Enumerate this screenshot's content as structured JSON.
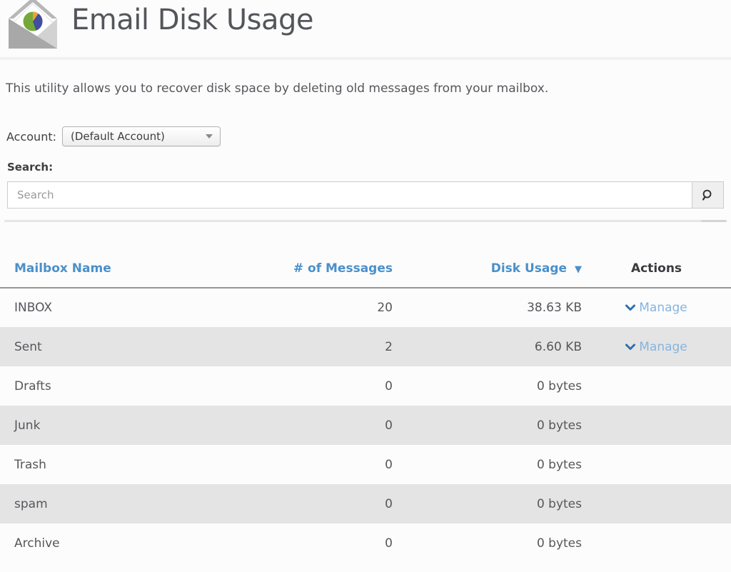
{
  "header": {
    "title": "Email Disk Usage",
    "icon": "envelope-pie-chart-icon"
  },
  "description": "This utility allows you to recover disk space by deleting old messages from your mailbox.",
  "account": {
    "label": "Account:",
    "selected": "(Default Account)"
  },
  "search": {
    "label": "Search:",
    "placeholder": "Search",
    "button_icon": "magnifier-icon"
  },
  "table": {
    "headers": {
      "mailbox": "Mailbox Name",
      "messages": "# of Messages",
      "disk_usage": "Disk Usage",
      "actions": "Actions"
    },
    "sort_indicator": "▼",
    "sorted_by": "Disk Usage",
    "sort_direction": "descending",
    "manage_label": "Manage",
    "rows": [
      {
        "mailbox": "INBOX",
        "messages": "20",
        "disk_usage": "38.63 KB",
        "manage": true
      },
      {
        "mailbox": "Sent",
        "messages": "2",
        "disk_usage": "6.60 KB",
        "manage": true
      },
      {
        "mailbox": "Drafts",
        "messages": "0",
        "disk_usage": "0 bytes",
        "manage": false
      },
      {
        "mailbox": "Junk",
        "messages": "0",
        "disk_usage": "0 bytes",
        "manage": false
      },
      {
        "mailbox": "Trash",
        "messages": "0",
        "disk_usage": "0 bytes",
        "manage": false
      },
      {
        "mailbox": "spam",
        "messages": "0",
        "disk_usage": "0 bytes",
        "manage": false
      },
      {
        "mailbox": "Archive",
        "messages": "0",
        "disk_usage": "0 bytes",
        "manage": false
      }
    ]
  },
  "colors": {
    "header_link_blue": "#4a90ca",
    "manage_text_blue": "#86b4e0",
    "manage_chevron_blue": "#2c70ae",
    "row_stripe_gray": "#e4e4e4",
    "title_gray": "#54565b",
    "pie_green": "#75a838",
    "pie_blue": "#424f9c",
    "pie_orange": "#efa03c"
  }
}
